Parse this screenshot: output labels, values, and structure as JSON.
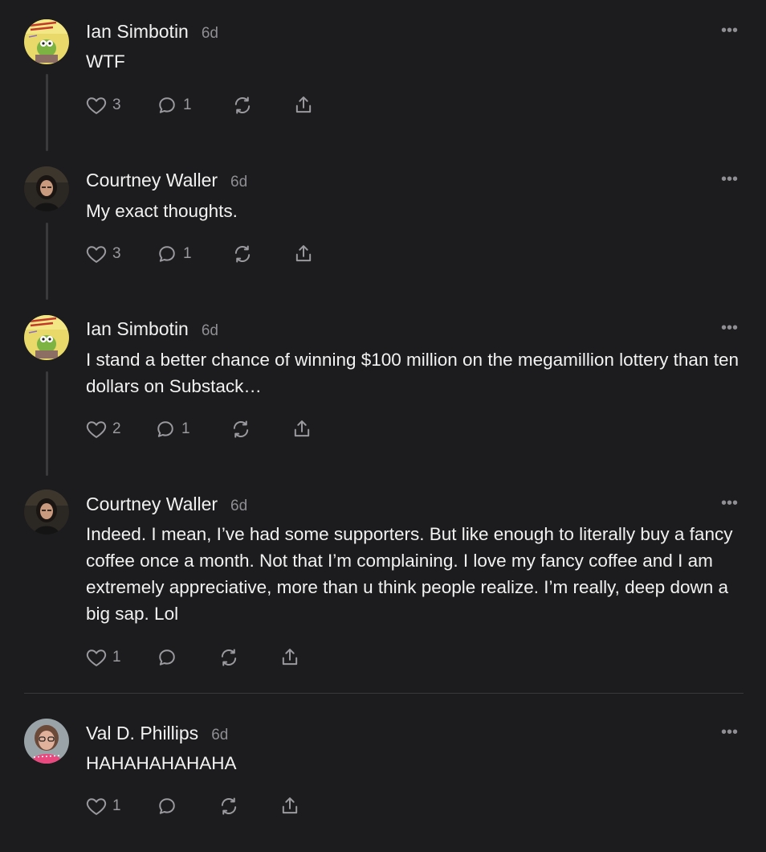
{
  "comments": [
    {
      "author": "Ian Simbotin",
      "time": "6d",
      "text": "WTF",
      "likes": "3",
      "replies": "1",
      "avatar": "cartoon-book-cover"
    },
    {
      "author": "Courtney Waller",
      "time": "6d",
      "text": "My exact thoughts.",
      "likes": "3",
      "replies": "1",
      "avatar": "woman-dark-hair-photo"
    },
    {
      "author": "Ian Simbotin",
      "time": "6d",
      "text": "I stand a better chance of winning $100 million on the megamillion lottery than ten dollars on Substack…",
      "likes": "2",
      "replies": "1",
      "avatar": "cartoon-book-cover"
    },
    {
      "author": "Courtney Waller",
      "time": "6d",
      "text": "Indeed. I mean, I’ve had some supporters. But like enough to literally buy a fancy coffee once a month. Not that I’m complaining. I love my fancy coffee and I am extremely appreciative, more than u think people realize. I’m really, deep down a big sap. Lol",
      "likes": "1",
      "replies": "",
      "avatar": "woman-dark-hair-photo"
    },
    {
      "author": "Val D. Phillips",
      "time": "6d",
      "text": "HAHAHAHAHAHA",
      "likes": "1",
      "replies": "",
      "avatar": "woman-glasses-pink-scarf-photo"
    }
  ],
  "more_glyph": "•••",
  "colors": {
    "background": "#1c1c1e",
    "text": "#f2f2f2",
    "muted": "#8e8e93",
    "thread_line": "#3a3a3c"
  },
  "icons": [
    "heart-icon",
    "comment-bubble-icon",
    "restack-icon",
    "share-icon",
    "more-icon"
  ]
}
